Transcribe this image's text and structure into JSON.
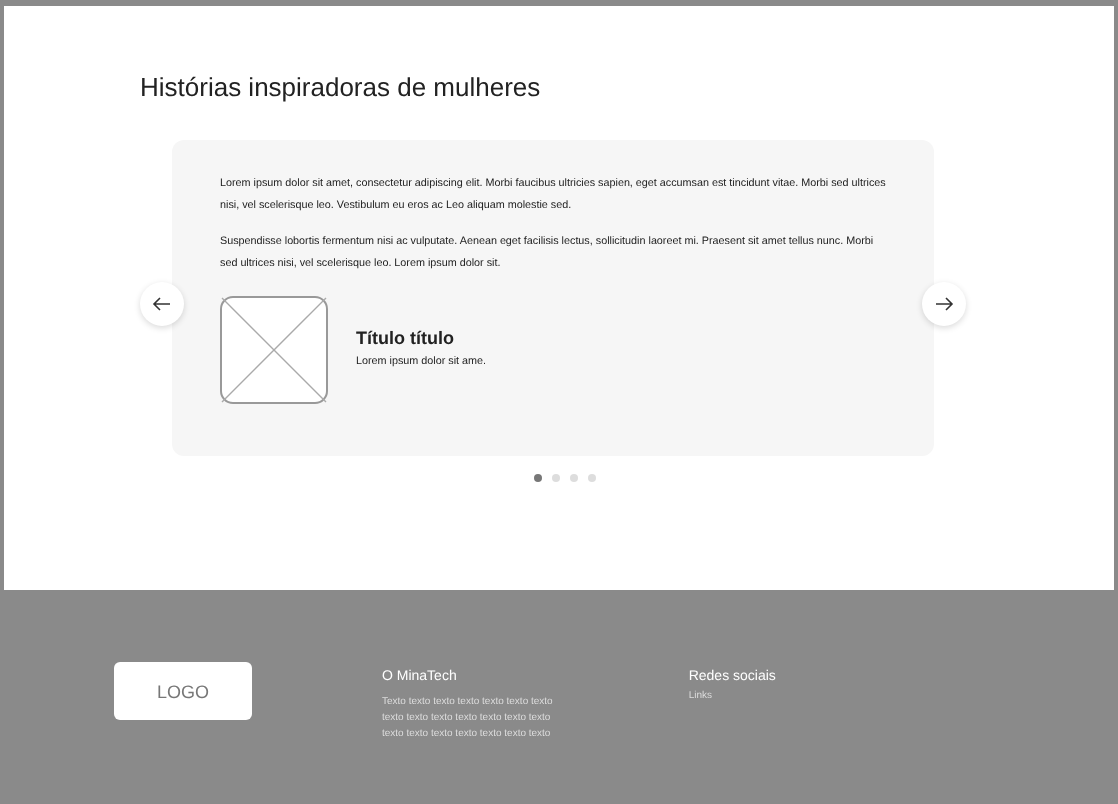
{
  "section": {
    "title": "Histórias inspiradoras de mulheres"
  },
  "carousel": {
    "paragraphs": [
      "Lorem ipsum dolor sit amet, consectetur adipiscing elit. Morbi faucibus ultricies sapien, eget accumsan est tincidunt vitae. Morbi sed ultrices nisi, vel scelerisque leo. Vestibulum eu eros ac Leo aliquam molestie sed.",
      "Suspendisse lobortis fermentum nisi ac vulputate. Aenean eget facilisis lectus, sollicitudin laoreet mi. Praesent sit amet tellus nunc. Morbi sed ultrices nisi, vel scelerisque leo. Lorem ipsum dolor sit."
    ],
    "person": {
      "name": "Título título",
      "subtitle": "Lorem ipsum dolor sit ame."
    },
    "dots": [
      {
        "selected": true
      },
      {
        "selected": false
      },
      {
        "selected": false
      },
      {
        "selected": false
      }
    ]
  },
  "footer": {
    "logo": "LOGO",
    "about": {
      "title": "O MinaTech",
      "lines": [
        "Texto texto texto texto texto texto texto",
        "texto texto texto texto texto texto texto",
        "texto texto texto texto texto texto texto"
      ]
    },
    "social": {
      "title": "Redes sociais",
      "link": "Links"
    }
  }
}
